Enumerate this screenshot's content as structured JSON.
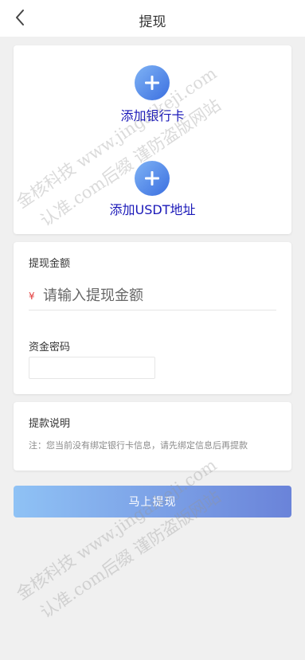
{
  "header": {
    "title": "提现",
    "back_icon": "chevron-left-icon"
  },
  "bind": {
    "bank_label": "添加银行卡",
    "usdt_label": "添加USDT地址",
    "plus_icon": "plus-icon"
  },
  "form": {
    "amount_label": "提现金额",
    "currency_symbol": "¥",
    "amount_placeholder": "请输入提现金额",
    "amount_value": "",
    "password_label": "资金密码",
    "password_value": ""
  },
  "note": {
    "title": "提款说明",
    "text": "注：您当前没有绑定银行卡信息，请先绑定信息后再提款"
  },
  "submit": {
    "label": "马上提现"
  },
  "watermark": {
    "line1": "金核科技 www.jingaikeji.com",
    "line2": "认准.com后缀 谨防盗版网站"
  },
  "colors": {
    "accent_blue": "#3b6fe0",
    "link_text": "#1a18b8",
    "currency_red": "#e23b3b",
    "button_start": "#8fc2f5",
    "button_end": "#6a83d9"
  }
}
